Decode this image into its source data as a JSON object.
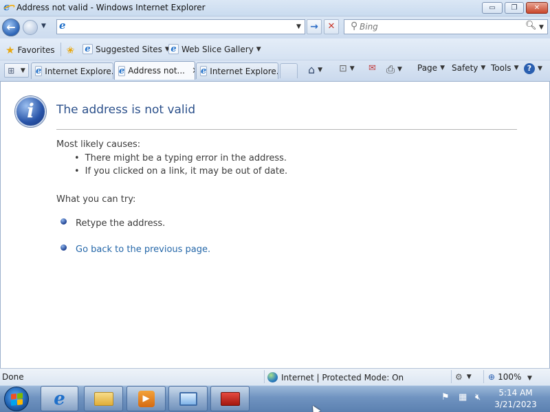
{
  "window": {
    "title": "Address not valid - Windows Internet Explorer",
    "buttons": {
      "minimize": "▭",
      "maximize": "❐",
      "close": "✕"
    }
  },
  "address_bar": {
    "value": "",
    "placeholder": ""
  },
  "search": {
    "placeholder": "Bing"
  },
  "favorites_bar": {
    "favorites_label": "Favorites",
    "suggested_sites": "Suggested Sites",
    "web_slice_gallery": "Web Slice Gallery"
  },
  "tabs": [
    {
      "label": "Internet Explore...",
      "active": false
    },
    {
      "label": "Address not...",
      "active": true
    },
    {
      "label": "Internet Explore...",
      "active": false
    }
  ],
  "command_bar": {
    "page": "Page",
    "safety": "Safety",
    "tools": "Tools"
  },
  "content": {
    "title": "The address is not valid",
    "causes_label": "Most likely causes:",
    "causes": [
      "There might be a typing error in the address.",
      "If you clicked on a link, it may be out of date."
    ],
    "try_label": "What you can try:",
    "try_items": [
      {
        "text": "Retype the address.",
        "link": false
      },
      {
        "text": "Go back to the previous page.",
        "link": true
      }
    ]
  },
  "status_bar": {
    "status": "Done",
    "zone": "Internet | Protected Mode: On",
    "zoom": "100%"
  },
  "taskbar": {
    "clock_time": "5:14 AM",
    "clock_date": "3/21/2023"
  },
  "colors": {
    "link": "#2366a8",
    "title": "#2a4f8a",
    "accent": "#1f6fc9"
  }
}
